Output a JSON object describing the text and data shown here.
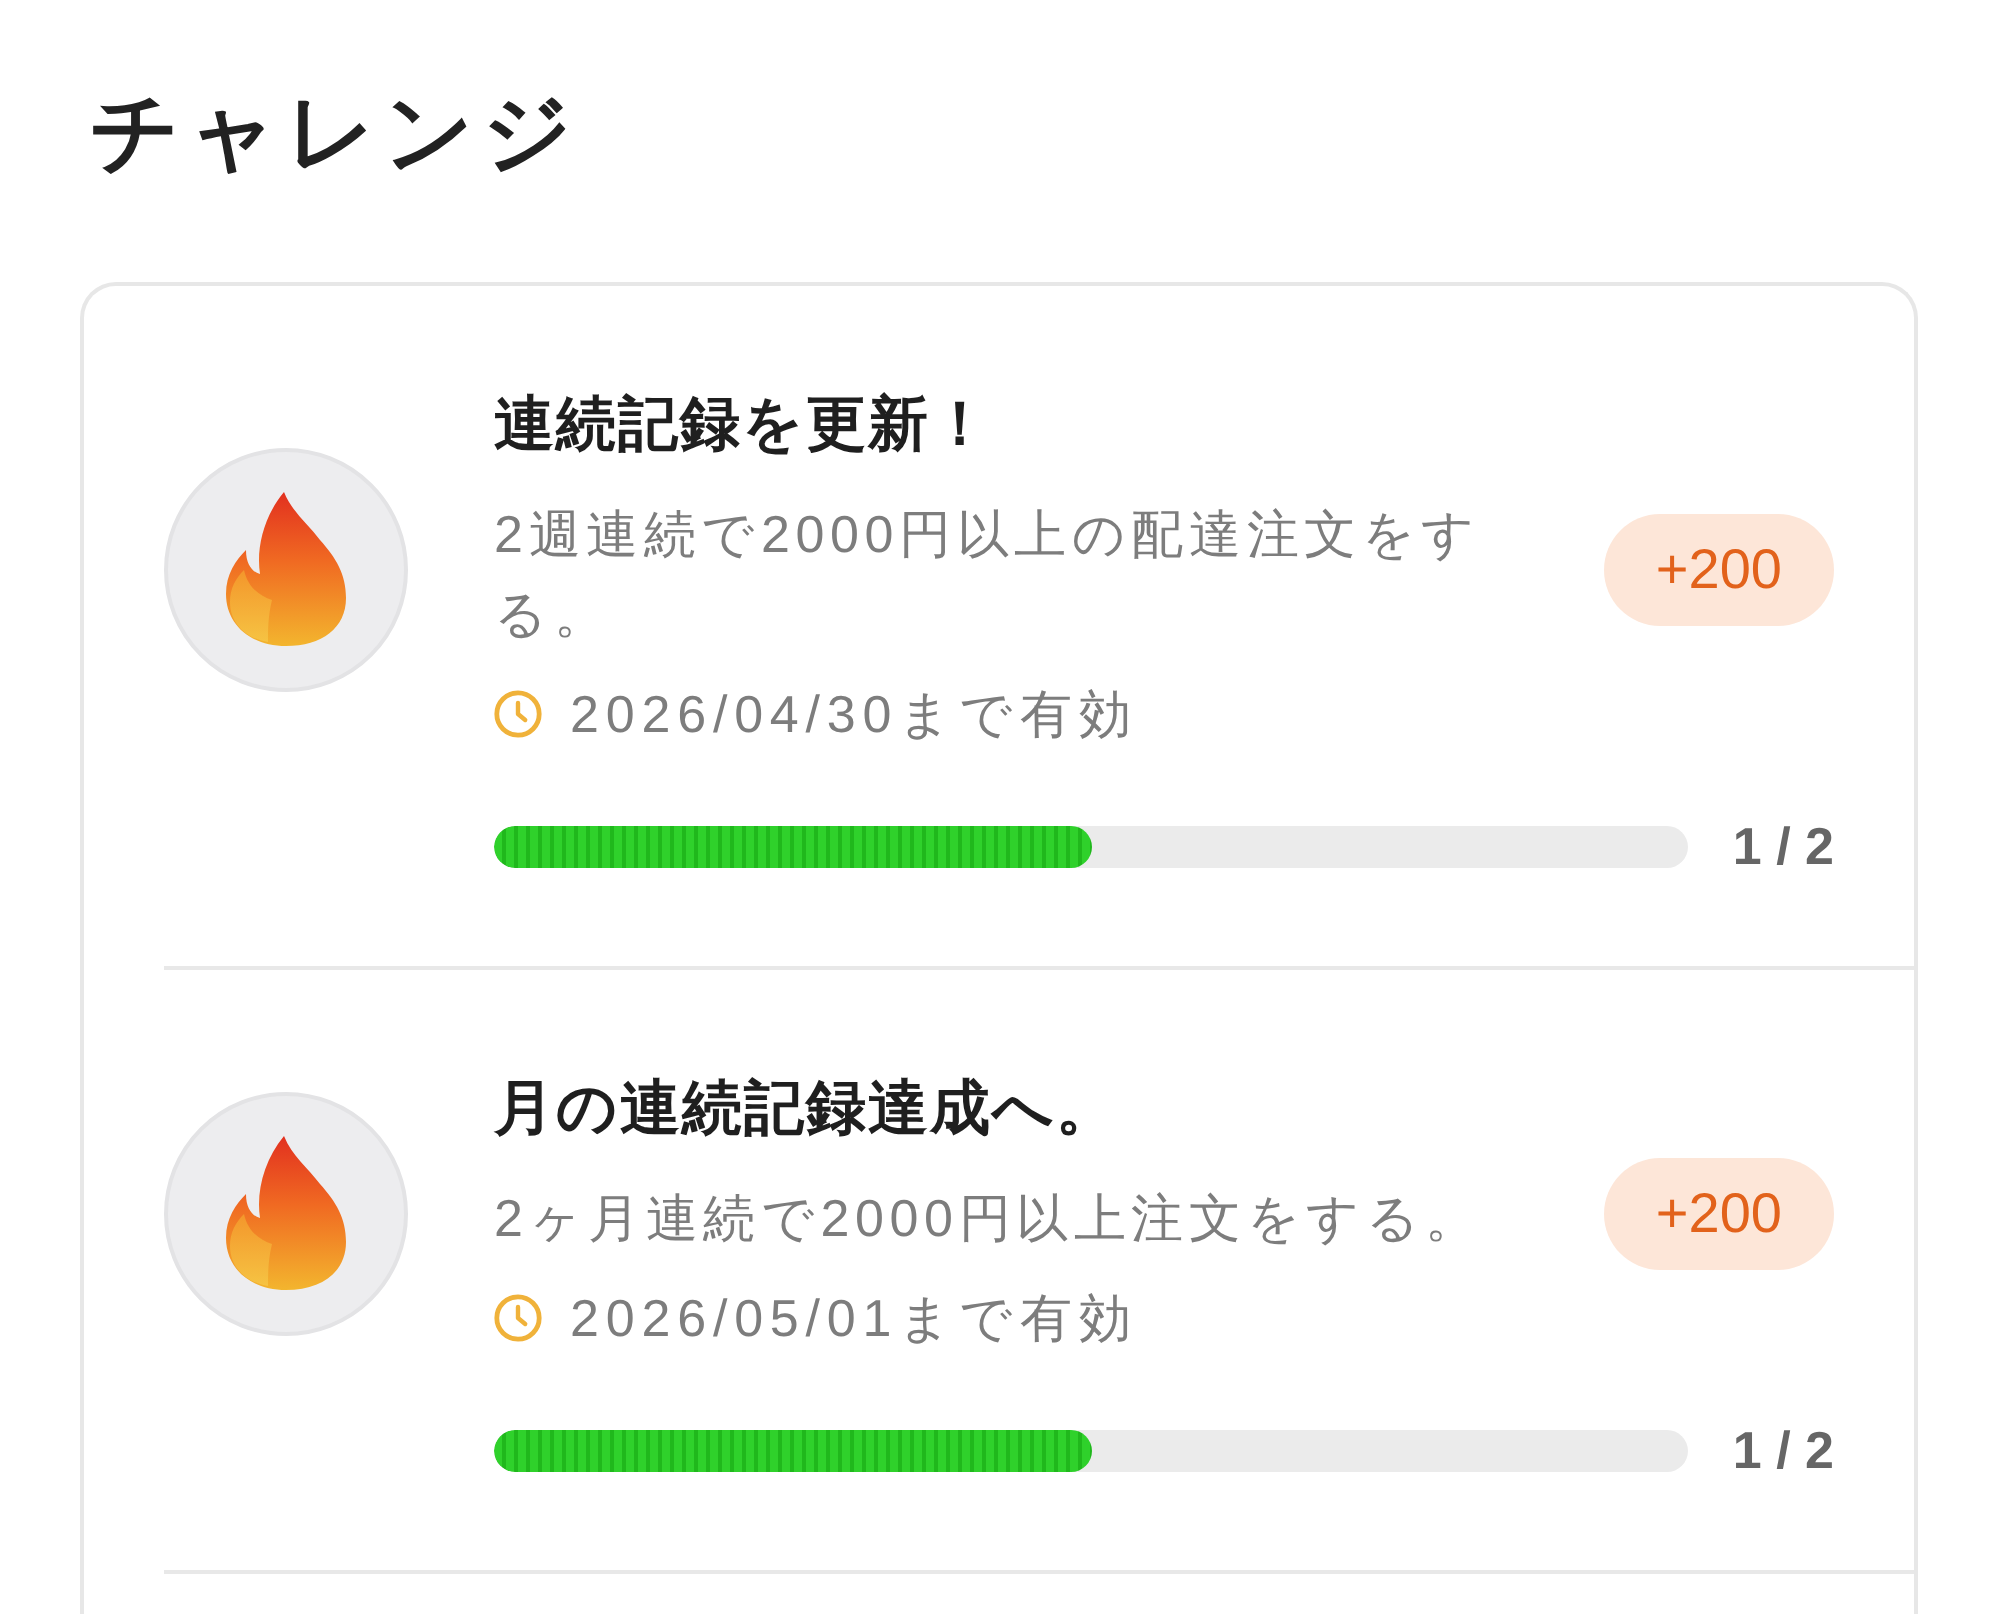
{
  "title": "チャレンジ",
  "challenges": [
    {
      "title": "連続記録を更新！",
      "description": "2週連続で2000円以上の配達注文をする。",
      "expiry": "2026/04/30まで有効",
      "points": "+200",
      "level": 0.5,
      "progress": "1 / 2"
    },
    {
      "title": "月の連続記録達成へ。",
      "description": "2ヶ月連続で2000円以上注文をする。",
      "expiry": "2026/05/01まで有効",
      "points": "+200",
      "level": 0.5,
      "progress": "1 / 2"
    }
  ]
}
